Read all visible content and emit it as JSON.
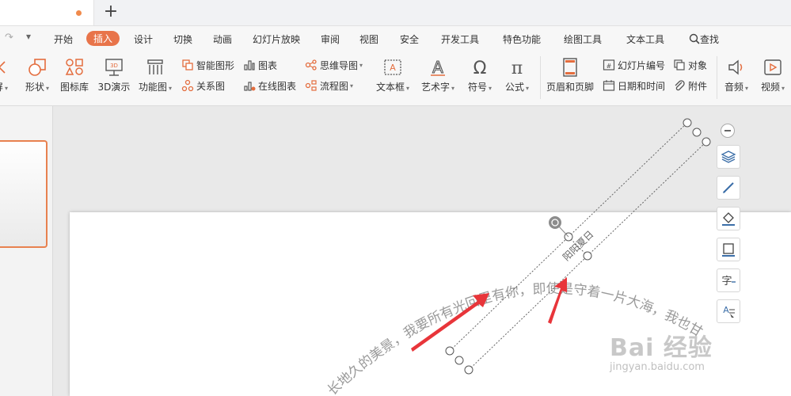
{
  "tabs": {
    "new_tab": "+"
  },
  "quick": {
    "redo": "↷",
    "dropdown": "▾"
  },
  "menu": {
    "start": "开始",
    "insert": "插入",
    "design": "设计",
    "transition": "切换",
    "animation": "动画",
    "slideshow": "幻灯片放映",
    "review": "审阅",
    "view": "视图",
    "security": "安全",
    "developer": "开发工具",
    "special": "特色功能",
    "drawing_tools": "绘图工具",
    "text_tools": "文本工具",
    "search": "查找"
  },
  "ribbon": {
    "screen_suffix": "屏",
    "shape": "形状",
    "icon_lib": "图标库",
    "demo3d": "3D演示",
    "func_chart": "功能图",
    "smart_graphic": "智能图形",
    "chart": "图表",
    "mindmap": "思维导图",
    "relation": "关系图",
    "online_chart": "在线图表",
    "flowchart": "流程图",
    "textbox": "文本框",
    "wordart": "艺术字",
    "symbol": "符号",
    "formula": "公式",
    "header_footer": "页眉和页脚",
    "slide_number": "幻灯片编号",
    "object": "对象",
    "datetime": "日期和时间",
    "attachment": "附件",
    "audio": "音频",
    "video": "视频",
    "icon_3d_text": "3D"
  },
  "canvas": {
    "selected_text": "阳阳夏日",
    "arc_text": "长地久的美景，我要所有光回里有你，即使是守着一片大海，我也甘"
  },
  "watermark": {
    "main": "Bai 经验",
    "sub": "jingyan.baidu.com"
  },
  "colors": {
    "accent": "#e8744a",
    "arrow": "#e8353a"
  }
}
